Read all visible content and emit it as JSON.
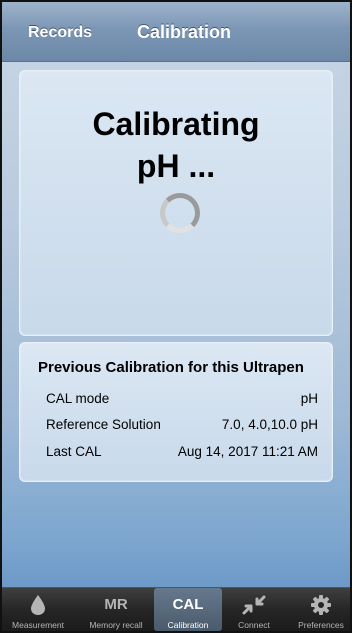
{
  "navbar": {
    "back_label": "Records",
    "title": "Calibration"
  },
  "status": {
    "line1": "Calibrating",
    "line2": "pH ..."
  },
  "previous": {
    "title": "Previous Calibration for this Ultrapen",
    "rows": [
      {
        "label": "CAL mode",
        "value": "pH"
      },
      {
        "label": "Reference Solution",
        "value": "7.0, 4.0,10.0 pH"
      },
      {
        "label": "Last CAL",
        "value": "Aug 14, 2017  11:21 AM"
      }
    ]
  },
  "tabbar": {
    "items": [
      {
        "icon": "droplet-icon",
        "icon_text": "",
        "label": "Measurement",
        "active": false
      },
      {
        "icon": "mr-text-icon",
        "icon_text": "MR",
        "label": "Memory recall",
        "active": false
      },
      {
        "icon": "cal-text-icon",
        "icon_text": "CAL",
        "label": "Calibration",
        "active": true
      },
      {
        "icon": "connect-arrows-icon",
        "icon_text": "",
        "label": "Connect",
        "active": false
      },
      {
        "icon": "gear-icon",
        "icon_text": "",
        "label": "Preferences",
        "active": false
      }
    ]
  },
  "colors": {
    "navbar": "#7c97b5",
    "tab_active": "#5a6b7e",
    "tabbar": "#262626"
  }
}
